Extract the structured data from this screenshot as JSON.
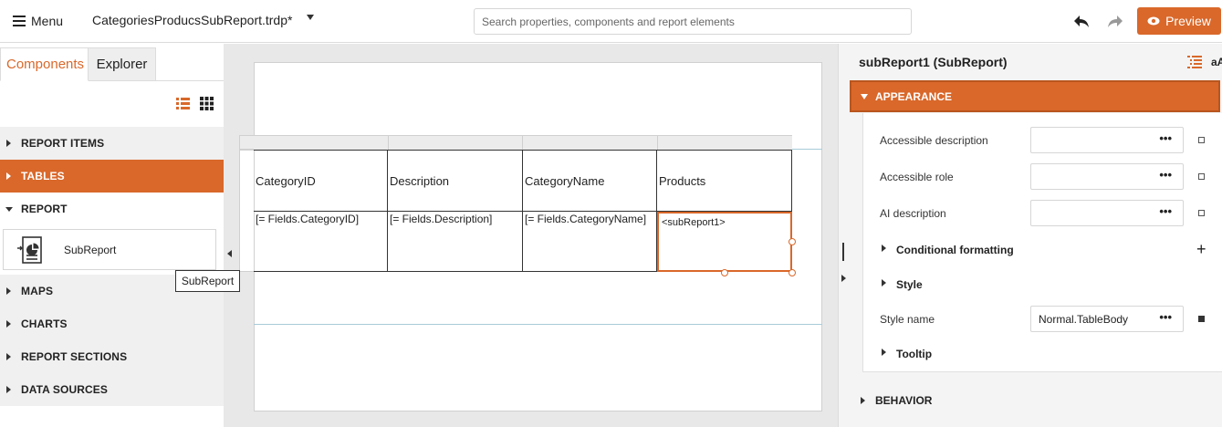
{
  "topbar": {
    "menu_label": "Menu",
    "file_name": "CategoriesProducsSubReport.trdp*",
    "search_placeholder": "Search properties, components and report elements",
    "preview_label": "Preview",
    "undo_icon": "undo-icon",
    "redo_icon": "redo-icon"
  },
  "left_panel": {
    "tabs": [
      {
        "label": "Components",
        "active": true
      },
      {
        "label": "Explorer",
        "active": false
      }
    ],
    "categories": [
      {
        "label": "REPORT ITEMS",
        "state": "collapsed"
      },
      {
        "label": "TABLES",
        "state": "active"
      },
      {
        "label": "REPORT",
        "state": "expanded"
      },
      {
        "label": "MAPS",
        "state": "collapsed"
      },
      {
        "label": "CHARTS",
        "state": "collapsed"
      },
      {
        "label": "REPORT SECTIONS",
        "state": "collapsed"
      },
      {
        "label": "DATA SOURCES",
        "state": "collapsed"
      }
    ],
    "report_items": [
      {
        "label": "SubReport",
        "icon": "subreport-icon"
      }
    ],
    "tooltip": "SubReport"
  },
  "canvas": {
    "table": {
      "headers": [
        "CategoryID",
        "Description",
        "CategoryName",
        "Products"
      ],
      "cells": [
        "[= Fields.CategoryID]",
        "[= Fields.Description]",
        "[= Fields.CategoryName]",
        "<subReport1>"
      ]
    }
  },
  "properties": {
    "title": "subReport1 (SubReport)",
    "sort_icon_label": "aA",
    "sections": {
      "appearance": "APPEARANCE",
      "behavior": "BEHAVIOR"
    },
    "items": [
      {
        "label": "Accessible description",
        "value": ""
      },
      {
        "label": "Accessible role",
        "value": ""
      },
      {
        "label": "AI description",
        "value": ""
      }
    ],
    "groups": {
      "conditional_formatting": "Conditional formatting",
      "style": "Style",
      "tooltip": "Tooltip"
    },
    "style_name": {
      "label": "Style name",
      "value": "Normal.TableBody"
    },
    "dots": "•••",
    "plus": "+"
  },
  "colors": {
    "accent": "#d9682a"
  }
}
